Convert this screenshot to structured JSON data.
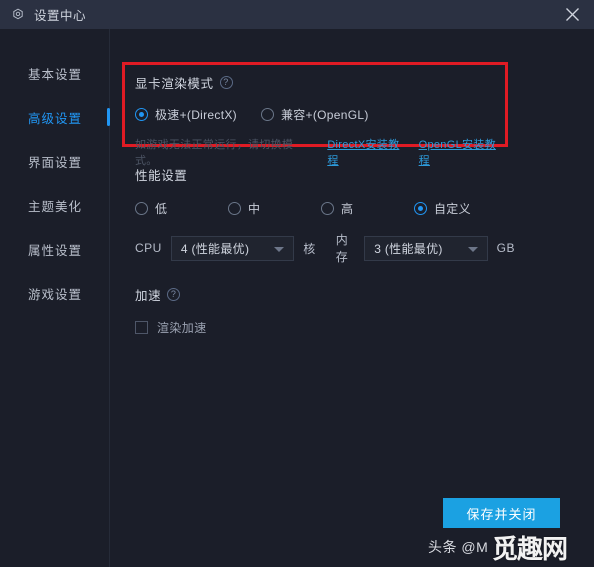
{
  "window": {
    "title": "设置中心",
    "gear_icon": "gear-icon",
    "close_icon": "close-icon"
  },
  "sidebar": {
    "items": [
      {
        "label": "基本设置",
        "active": false
      },
      {
        "label": "高级设置",
        "active": true
      },
      {
        "label": "界面设置",
        "active": false
      },
      {
        "label": "主题美化",
        "active": false
      },
      {
        "label": "属性设置",
        "active": false
      },
      {
        "label": "游戏设置",
        "active": false
      }
    ]
  },
  "render_mode": {
    "title": "显卡渲染模式",
    "help_icon": "?",
    "options": [
      {
        "label": "极速+(DirectX)",
        "checked": true
      },
      {
        "label": "兼容+(OpenGL)",
        "checked": false
      }
    ],
    "hint": "如游戏无法正常运行，请切换模式。",
    "links": [
      "DirectX安装教程",
      "OpenGL安装教程"
    ],
    "highlight_color": "#e01b24"
  },
  "performance": {
    "title": "性能设置",
    "options": [
      {
        "label": "低",
        "checked": false
      },
      {
        "label": "中",
        "checked": false
      },
      {
        "label": "高",
        "checked": false
      },
      {
        "label": "自定义",
        "checked": true
      }
    ],
    "cpu": {
      "label": "CPU",
      "value": "4 (性能最优)",
      "unit": "核"
    },
    "memory": {
      "label": "内存",
      "value": "3 (性能最优)",
      "unit": "GB"
    }
  },
  "acceleration": {
    "title": "加速",
    "help_icon": "?",
    "checkbox": {
      "label": "渲染加速",
      "checked": false
    }
  },
  "footer": {
    "save_label": "保存并关闭",
    "accent_color": "#1ba1e2"
  },
  "watermark": {
    "author": "头条 @M",
    "logo": "觅趣网"
  }
}
